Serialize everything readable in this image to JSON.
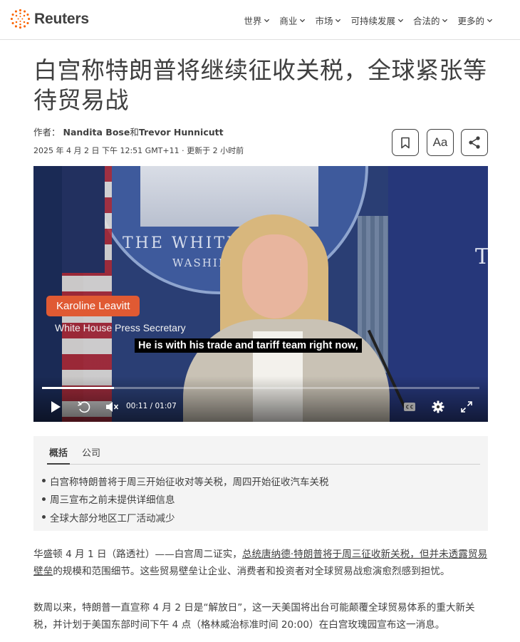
{
  "header": {
    "logo_text": "Reuters",
    "nav": [
      "世界",
      "商业",
      "市场",
      "可持续发展",
      "合法的",
      "更多的"
    ]
  },
  "article": {
    "headline": "白宫称特朗普将继续征收关税，全球紧张等待贸易战",
    "byline_prefix": "作者：",
    "author1": "Nandita Bose",
    "author_joiner": "和",
    "author2": "Trevor Hunnicutt",
    "dateline": "2025 年 4 月 2 日 下午 12:51 GMT+11 · 更新于 2 小时前",
    "font_button_label": "Aa"
  },
  "video": {
    "lower_third_name": "Karoline Leavitt",
    "lower_third_title": "White House Press Secretary",
    "caption": "He is with his trade and tariff team right now,",
    "background_text_1": "THE WHITE",
    "background_text_2": "WASHIN",
    "background_text_3": "T",
    "current_time": "00:11",
    "time_separator": "/",
    "duration": "01:07",
    "progress": 0.165
  },
  "summary": {
    "tabs": [
      "概括",
      "公司"
    ],
    "active_tab": 0,
    "bullets": [
      "白宫称特朗普将于周三开始征收对等关税，周四开始征收汽车关税",
      "周三宣布之前未提供详细信息",
      "全球大部分地区工厂活动减少"
    ]
  },
  "body": {
    "p1_lead": "华盛顿 4 月 1 日（路透社）——白宫周二证实，",
    "p1_link": "总统唐纳德·特朗普将于周三征收新关税，但并未透露贸易壁垒",
    "p1_rest": "的规模和范围细节。这些贸易壁垒让企业、消费者和投资者对全球贸易战愈演愈烈感到担忧。",
    "p2": "数周以来，特朗普一直宣称 4 月 2 日是“解放日”，这一天美国将出台可能颠覆全球贸易体系的重大新关税，并计划于美国东部时间下午 4 点（格林威治标准时间 20:00）在白宫玫瑰园宣布这一消息。"
  },
  "colors": {
    "logo_accent": "#fa6400",
    "text": "#404040",
    "lower_third": "#e05a33",
    "summary_bg": "#f4f4f4"
  }
}
